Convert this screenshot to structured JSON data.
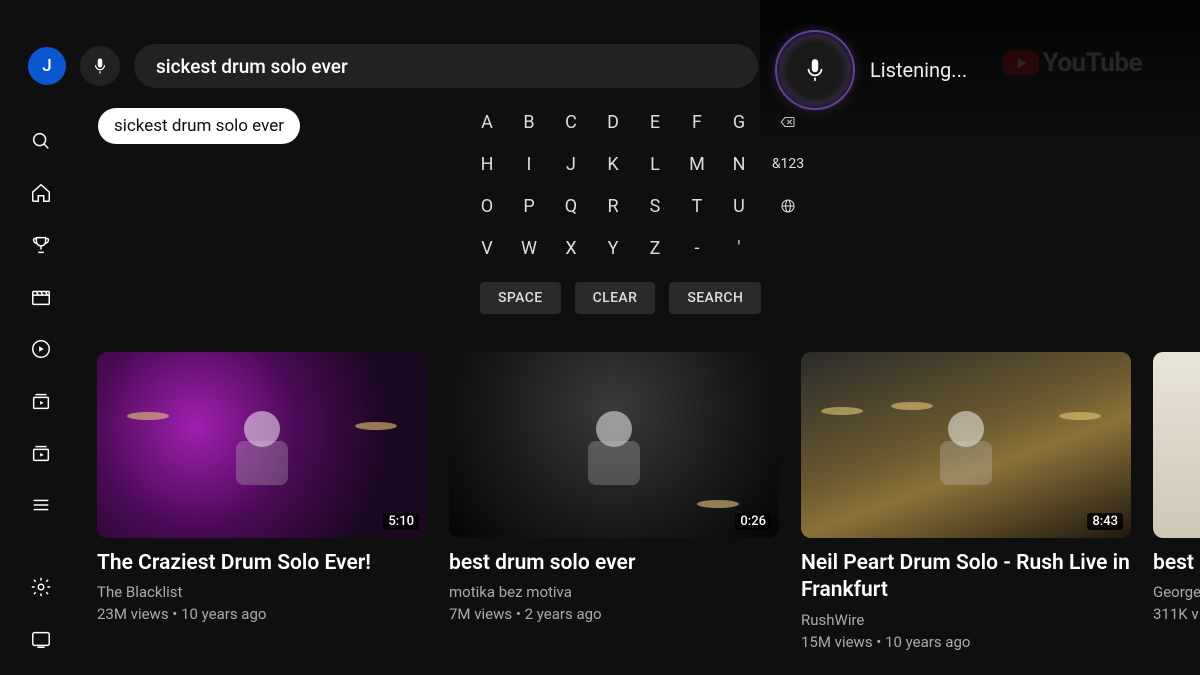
{
  "avatar_initial": "J",
  "search": {
    "query": "sickest drum solo ever",
    "suggestion": "sickest drum solo ever"
  },
  "voice": {
    "status_label": "Listening..."
  },
  "brand": "YouTube",
  "keyboard": {
    "rows": [
      [
        "A",
        "B",
        "C",
        "D",
        "E",
        "F",
        "G"
      ],
      [
        "H",
        "I",
        "J",
        "K",
        "L",
        "M",
        "N"
      ],
      [
        "O",
        "P",
        "Q",
        "R",
        "S",
        "T",
        "U"
      ],
      [
        "V",
        "W",
        "X",
        "Y",
        "Z",
        "-",
        "'"
      ]
    ],
    "extra_r1": "",
    "extra_r2": "&123",
    "actions": {
      "space": "SPACE",
      "clear": "CLEAR",
      "search": "SEARCH"
    }
  },
  "videos": [
    {
      "title": "The Craziest Drum Solo Ever!",
      "channel": "The Blacklist",
      "meta": "23M views • 10 years ago",
      "duration": "5:10",
      "thumb_bg": "radial-gradient(circle at 30% 40%, #a020b0 0%, #4a0a55 40%, #1a0820 75%)"
    },
    {
      "title": "best drum solo ever",
      "channel": "motika bez motiva",
      "meta": "7M views • 2 years ago",
      "duration": "0:26",
      "thumb_bg": "radial-gradient(circle at 50% 30%, #3a3a3a 0%, #181818 60%, #050505 100%)"
    },
    {
      "title": "Neil Peart Drum Solo - Rush Live in Frankfurt",
      "channel": "RushWire",
      "meta": "15M views • 10 years ago",
      "duration": "8:43",
      "thumb_bg": "linear-gradient(160deg,#2b2b2a 0%, #6b5a30 45%, #8a7238 60%, #201810 100%)"
    },
    {
      "title": "best",
      "channel": "George",
      "meta": "311K v",
      "duration": "",
      "thumb_bg": "linear-gradient(#e8e4d8,#cfc7b5)"
    }
  ]
}
